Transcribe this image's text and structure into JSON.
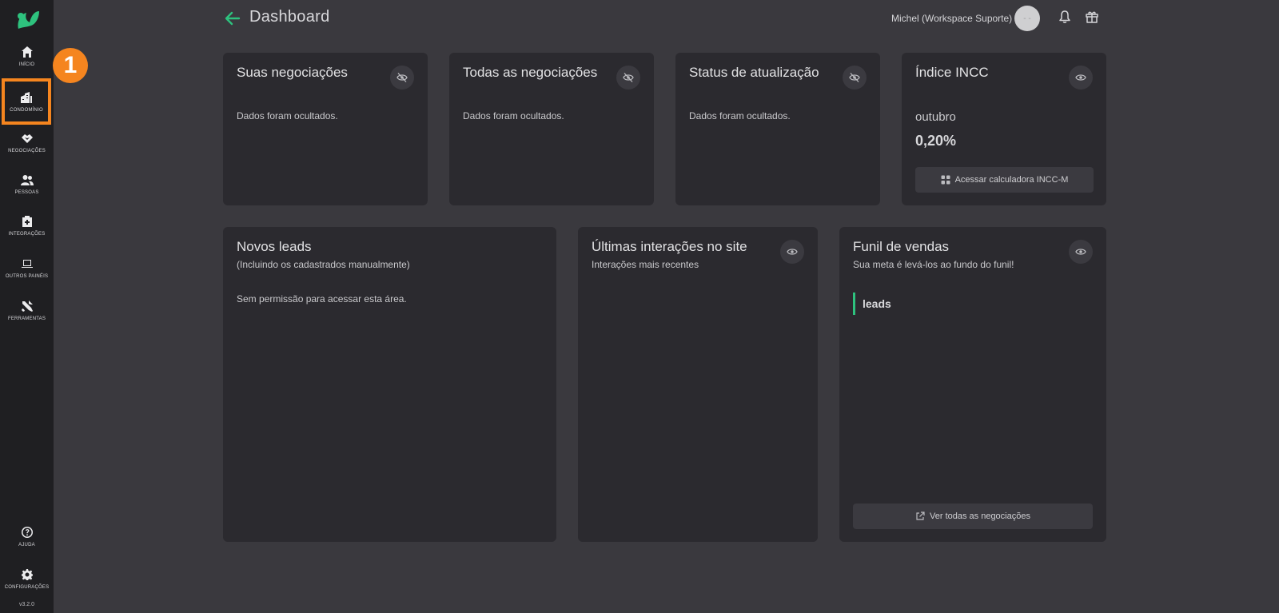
{
  "header": {
    "title": "Dashboard",
    "user_name": "Michel (Workspace Suporte)",
    "avatar_text": "- -"
  },
  "sidebar": {
    "items": [
      {
        "label": "INÍCIO",
        "icon": "home-icon"
      },
      {
        "label": "CONDOMÍNIO",
        "icon": "building-icon"
      },
      {
        "label": "NEGOCIAÇÕES",
        "icon": "handshake-icon"
      },
      {
        "label": "PESSOAS",
        "icon": "people-icon"
      },
      {
        "label": "INTEGRAÇÕES",
        "icon": "integrations-icon"
      },
      {
        "label": "OUTROS PAINÉIS",
        "icon": "laptop-icon"
      },
      {
        "label": "FERRAMENTAS",
        "icon": "tools-icon"
      },
      {
        "label": "AJUDA",
        "icon": "help-icon"
      },
      {
        "label": "CONFIGURAÇÕES",
        "icon": "gear-icon"
      }
    ],
    "version": "v3.2.0"
  },
  "annotation": {
    "step": "1"
  },
  "cards": {
    "suas_negociacoes": {
      "title": "Suas negociações",
      "text": "Dados foram ocultados."
    },
    "todas_negociacoes": {
      "title": "Todas as negociações",
      "text": "Dados foram ocultados."
    },
    "status_atualizacao": {
      "title": "Status de atualização",
      "text": "Dados foram ocultados."
    },
    "indice_incc": {
      "title": "Índice INCC",
      "month": "outubro",
      "value": "0,20%",
      "button": "Acessar calculadora INCC-M"
    },
    "novos_leads": {
      "title": "Novos leads",
      "subtitle": "(Incluindo os cadastrados manualmente)",
      "text": "Sem permissão para acessar esta área."
    },
    "ultimas_interacoes": {
      "title": "Últimas interações no site",
      "subtitle": "Interações mais recentes"
    },
    "funil_vendas": {
      "title": "Funil de vendas",
      "subtitle": "Sua meta é levá-los ao fundo do funil!",
      "stage": "leads",
      "button": "Ver todas as negociações"
    }
  },
  "colors": {
    "accent": "#2ec27e",
    "highlight": "#f5851f",
    "background": "#3a393e",
    "sidebar": "#1f1f22",
    "card": "#2b2a2f"
  }
}
